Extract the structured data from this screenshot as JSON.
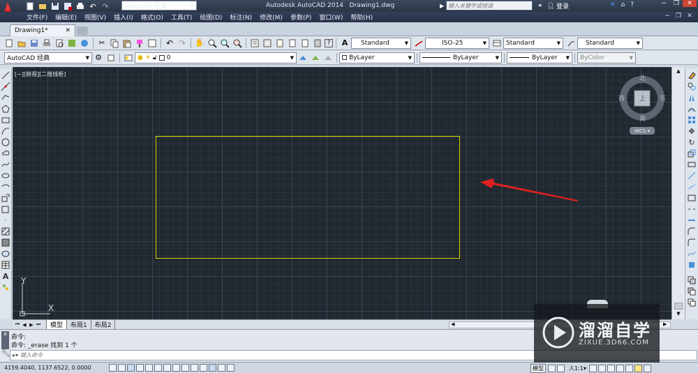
{
  "title": {
    "app": "Autodesk AutoCAD 2014",
    "file": "Drawing1.dwg",
    "workspace": "AutoCAD 经典",
    "search_placeholder": "键入关键字或短语",
    "login": "登录"
  },
  "menu": [
    "文件(F)",
    "编辑(E)",
    "视图(V)",
    "插入(I)",
    "格式(O)",
    "工具(T)",
    "绘图(D)",
    "标注(N)",
    "修改(M)",
    "参数(P)",
    "窗口(W)",
    "帮助(H)"
  ],
  "doc_tab": "Drawing1*",
  "styles": {
    "text_style": "Standard",
    "dim_style": "ISO-25",
    "table_style": "Standard",
    "multileader_style": "Standard"
  },
  "layers": {
    "workspace": "AutoCAD 经典",
    "layer": "0",
    "color": "ByLayer",
    "linetype": "ByLayer",
    "lineweight": "ByLayer",
    "plotstyle": "ByColor"
  },
  "viewport": {
    "label": "[−][俯视][二维线框]",
    "compass": {
      "n": "北",
      "s": "南",
      "e": "东",
      "w": "西",
      "center": "上"
    },
    "wcs": "WCS",
    "ucs_x": "X",
    "ucs_y": "Y",
    "rect_color": "#d8d200",
    "arrow_color": "#e02020"
  },
  "layout_tabs": [
    "模型",
    "布局1",
    "布局2"
  ],
  "command": {
    "line1": "命令:",
    "line2": "命令: _erase 找到 1 个",
    "prompt": "键入命令"
  },
  "status": {
    "coords": "4159.4040, 1137.6522, 0.0000",
    "model": "模型",
    "scale": "人1:1▾"
  },
  "watermark": {
    "brand": "溜溜自学",
    "url": "ZIXUE.3D66.COM"
  }
}
